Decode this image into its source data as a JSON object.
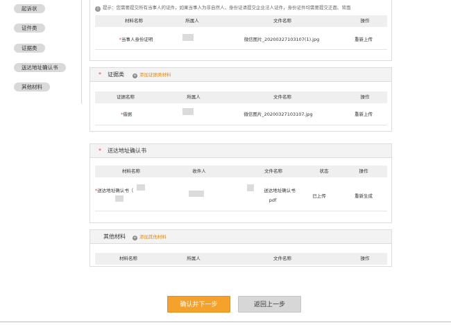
{
  "sidebar": {
    "items": [
      {
        "label": "起诉状"
      },
      {
        "label": "证件类"
      },
      {
        "label": "证据类"
      },
      {
        "label": "送达地址确认书"
      },
      {
        "label": "其他材料"
      }
    ]
  },
  "hint": "提示：您需要提交所有当事人的证件，如果当事人为非自然人，身份证请提交企业法人证件，身份证件均需要提交正面、背面",
  "identity_table": {
    "headers": [
      "材料名称",
      "所属人",
      "文件名称",
      "操作"
    ],
    "row": {
      "name": "当事人身份证明",
      "file": "微信图片_20200327103107(1).jpg",
      "action": "重新上传"
    }
  },
  "evidence_panel": {
    "title": "证据类",
    "add_label": "添加证据类材料",
    "headers": [
      "证据名称",
      "所属人",
      "文件名称",
      "操作"
    ],
    "row": {
      "name": "借据",
      "file": "微信图片_20200327103107.jpg",
      "action": "重新上传"
    }
  },
  "address_panel": {
    "title": "送达地址确认书",
    "headers": [
      "材料名称",
      "收件人",
      "文件名称",
      "状态",
      "操作"
    ],
    "row": {
      "name": "送达地址确认书（",
      "file": "送达地址确认书",
      "file_ext": "pdf",
      "status": "已上传",
      "action": "重新生成"
    }
  },
  "other_panel": {
    "title": "其他材料",
    "add_label": "添加其他材料",
    "headers": [
      "材料名称",
      "所属人",
      "文件名称",
      "操作"
    ]
  },
  "footer": {
    "confirm_label": "确认并下一步",
    "back_label": "返回上一步"
  },
  "colors": {
    "accent": "#f5a22d",
    "required": "#e0452f",
    "link": "#e08a16"
  }
}
